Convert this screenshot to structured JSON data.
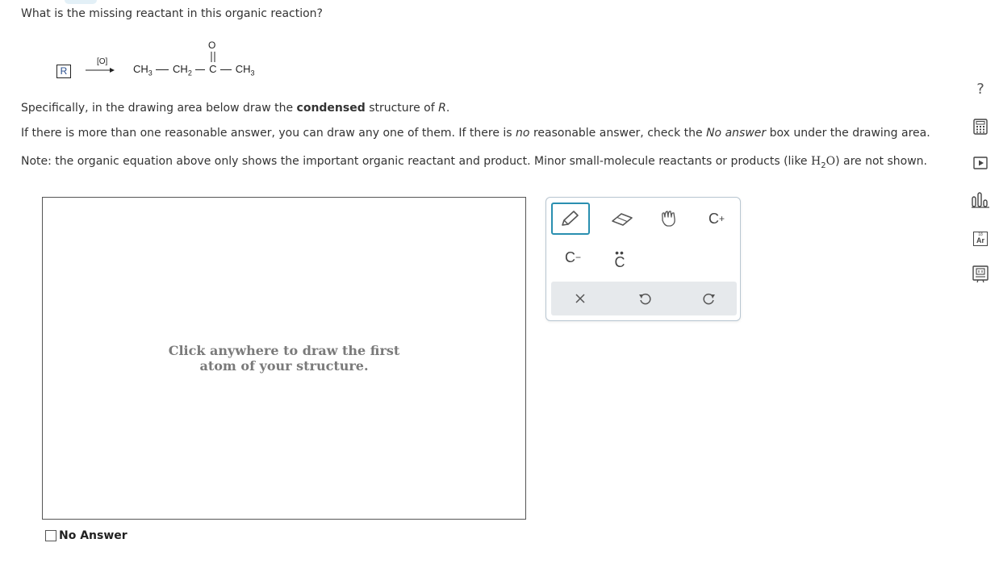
{
  "question": {
    "title": "What is the missing reactant in this organic reaction?",
    "line1_pre": "Specifically, in the drawing area below draw the ",
    "line1_bold": "condensed",
    "line1_post": " structure of ",
    "line1_var": "R",
    "line1_end": ".",
    "line2_pre": "If there is more than one reasonable answer, you can draw any one of them. If there is ",
    "line2_em1": "no",
    "line2_mid": " reasonable answer, check the ",
    "line2_em2": "No answer",
    "line2_post": " box under the drawing area.",
    "line3_pre": "Note: the organic equation above only shows the important organic reactant and product. Minor small-molecule reactants or products (like ",
    "line3_h": "H",
    "line3_sub": "2",
    "line3_o": "O",
    "line3_post": ") are not shown."
  },
  "reaction": {
    "reactant": "R",
    "reagent": "[O]",
    "o_atom": "O",
    "product": {
      "ch3a": "CH",
      "sub3a": "3",
      "ch2": "CH",
      "sub2": "2",
      "c": "C",
      "ch3b": "CH",
      "sub3b": "3"
    }
  },
  "drawing_area": {
    "hint_line1": "Click anywhere to draw the first",
    "hint_line2": "atom of your structure."
  },
  "no_answer_label": "No Answer",
  "toolbox": {
    "tools": [
      "pencil-icon",
      "eraser-icon",
      "hand-icon",
      "carbocation-icon",
      "carbanion-icon",
      "lone-pair-icon"
    ],
    "carbocation": "C",
    "carbocation_sup": "+",
    "carbanion": "C",
    "carbanion_sup": "−",
    "lone_pair": "C",
    "actions": [
      "clear-icon",
      "undo-icon",
      "redo-icon"
    ]
  },
  "sidebar": {
    "help": "?",
    "icons": [
      "help-icon",
      "calculator-icon",
      "video-icon",
      "chart-icon",
      "periodic-table-icon",
      "reference-icon"
    ],
    "periodic_label": "Ar",
    "periodic_number": "18"
  },
  "colors": {
    "accent": "#2a8fb0",
    "text": "#333333",
    "hint": "#7a7a7a"
  }
}
